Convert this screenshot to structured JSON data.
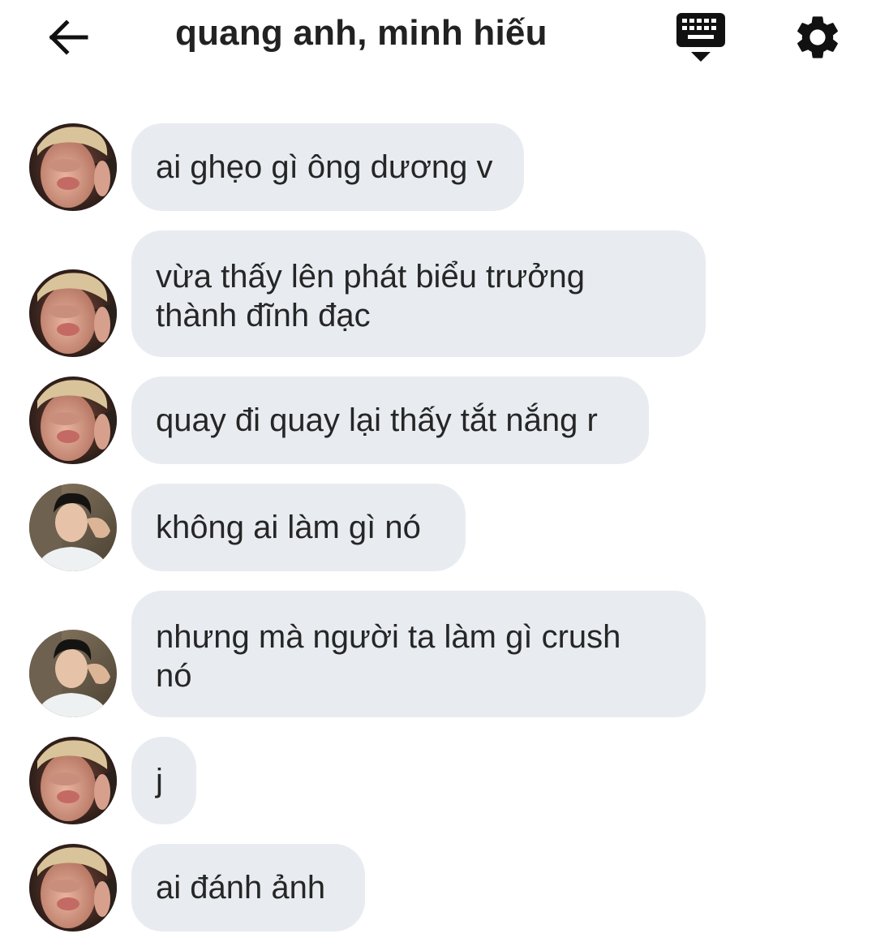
{
  "header": {
    "title": "quang anh, minh hiếu",
    "back_icon": "arrow-left-icon",
    "keyboard_icon": "keyboard-hide-icon",
    "settings_icon": "gear-icon"
  },
  "colors": {
    "bubble": "#e8ecf1",
    "text": "#262626",
    "background": "#ffffff"
  },
  "messages": [
    {
      "sender": "quang anh",
      "text": "ai ghẹo gì ông dương v"
    },
    {
      "sender": "quang anh",
      "text": "vừa thấy lên phát biểu trưởng thành đĩnh đạc"
    },
    {
      "sender": "quang anh",
      "text": "quay đi quay lại thấy tắt nắng r"
    },
    {
      "sender": "minh hiếu",
      "text": "không ai làm gì nó"
    },
    {
      "sender": "minh hiếu",
      "text": "nhưng mà người ta làm gì crush nó"
    },
    {
      "sender": "quang anh",
      "text": "j"
    },
    {
      "sender": "quang anh",
      "text": "ai đánh ảnh"
    }
  ]
}
